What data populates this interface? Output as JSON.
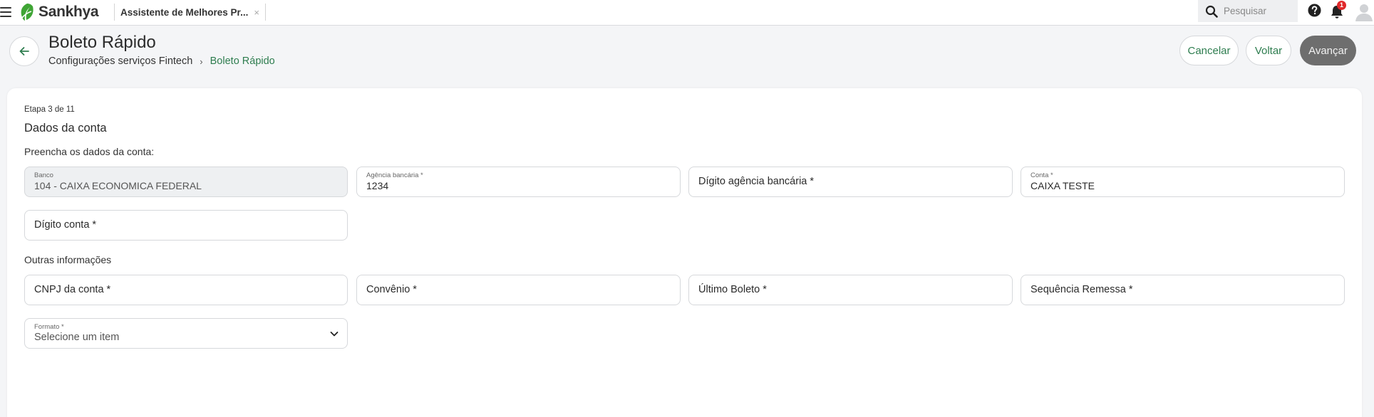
{
  "app": {
    "logo_text": "Sankhya",
    "tab_title": "Assistente de Melhores Pr...",
    "tab_close": "×"
  },
  "topbar": {
    "search_placeholder": "Pesquisar",
    "notification_count": "1"
  },
  "header": {
    "title": "Boleto Rápido",
    "breadcrumb": [
      "Configurações serviços Fintech",
      "Boleto Rápido"
    ],
    "breadcrumb_sep": "›",
    "buttons": {
      "cancel": "Cancelar",
      "back": "Voltar",
      "next": "Avançar"
    }
  },
  "form": {
    "step": "Etapa 3 de 11",
    "title": "Dados da conta",
    "subtitle": "Preencha os dados da conta:",
    "fields": {
      "banco": {
        "label": "Banco",
        "value": "104 - CAIXA ECONOMICA FEDERAL"
      },
      "agencia": {
        "label": "Agência bancária *",
        "value": "1234"
      },
      "digito_agencia": {
        "placeholder": "Dígito agência bancária *"
      },
      "conta": {
        "label": "Conta *",
        "value": "CAIXA TESTE"
      },
      "digito_conta": {
        "placeholder": "Dígito conta *"
      }
    },
    "other_section": "Outras informações",
    "other_fields": {
      "cnpj": {
        "placeholder": "CNPJ da conta *"
      },
      "convenio": {
        "placeholder": "Convênio *"
      },
      "ultimo_boleto": {
        "placeholder": "Último Boleto *"
      },
      "sequencia_remessa": {
        "placeholder": "Sequência Remessa *"
      },
      "formato": {
        "label": "Formato *",
        "value": "Selecione um item"
      }
    }
  },
  "colors": {
    "brand_green": "#3fa535",
    "link_green": "#2e7d4f",
    "primary_button": "#6e6e6e",
    "badge_red": "#e0282a"
  }
}
